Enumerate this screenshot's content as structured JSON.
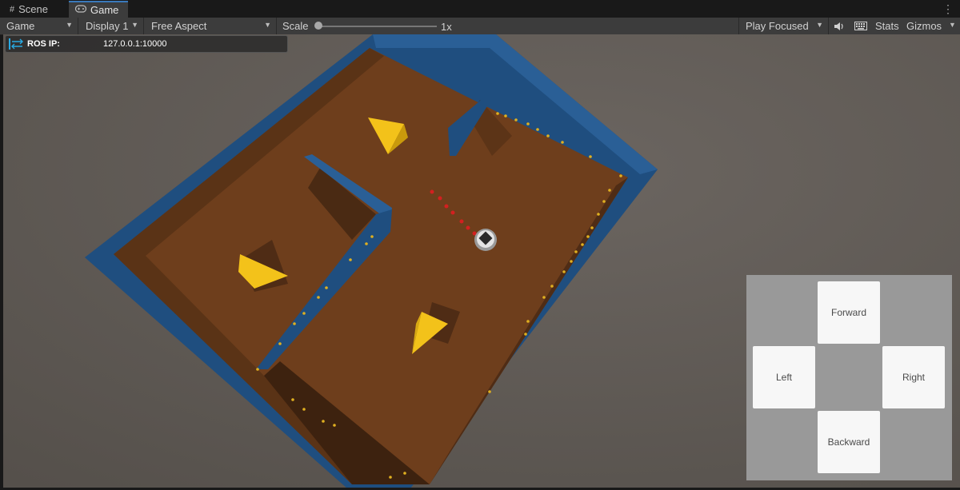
{
  "tabs": {
    "scene": {
      "label": "Scene",
      "icon": "grid-icon"
    },
    "game": {
      "label": "Game",
      "icon": "gamepad-icon"
    }
  },
  "toolbar": {
    "game_select": "Game",
    "display_select": "Display 1",
    "aspect_select": "Free Aspect",
    "scale_label": "Scale",
    "scale_value": "1x",
    "scale_slider_level": 0,
    "play_mode_select": "Play Focused",
    "stats_label": "Stats",
    "gizmos_label": "Gizmos"
  },
  "ros_panel": {
    "label": "ROS IP:",
    "value": "127.0.0.1:10000"
  },
  "controls": {
    "forward": "Forward",
    "left": "Left",
    "right": "Right",
    "backward": "Backward"
  },
  "colors": {
    "arena_floor": "#6e3e1c",
    "arena_wall": "#1f4e7f",
    "goal_objects": "#f3c21a",
    "path_markers": "#d32020",
    "tab_accent": "#3a79bb",
    "ros_connection_icon": "#29a9e1"
  }
}
